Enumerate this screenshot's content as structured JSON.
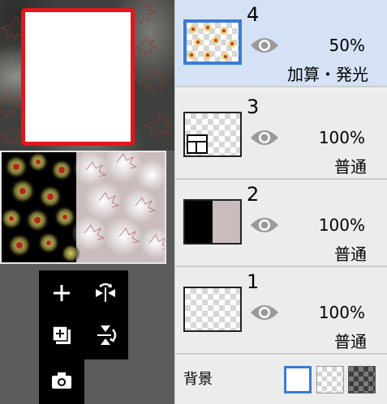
{
  "colors": {
    "selection_frame": "#e4161a",
    "selected_row_bg": "#d5e2f5",
    "selection_blue": "#3b7bd4",
    "toolbox_bg": "#000000",
    "panel_bg": "#ececec"
  },
  "toolbox": {
    "icons": [
      "plus-icon",
      "flip-horizontal-icon",
      "add-layer-icon",
      "flip-vertical-icon",
      "camera-icon"
    ]
  },
  "layers": [
    {
      "number": "4",
      "opacity": "50%",
      "blend": "加算・発光",
      "selected": true,
      "thumb": "maple-leaves-pattern"
    },
    {
      "number": "3",
      "opacity": "100%",
      "blend": "普通",
      "selected": false,
      "thumb": "layer-tile-icon"
    },
    {
      "number": "2",
      "opacity": "100%",
      "blend": "普通",
      "selected": false,
      "thumb": "black-and-mauve-split"
    },
    {
      "number": "1",
      "opacity": "100%",
      "blend": "普通",
      "selected": false,
      "thumb": "transparent"
    }
  ],
  "background": {
    "label": "背景",
    "options": [
      "white",
      "light-checker",
      "dark-checker"
    ],
    "selected": "white"
  }
}
